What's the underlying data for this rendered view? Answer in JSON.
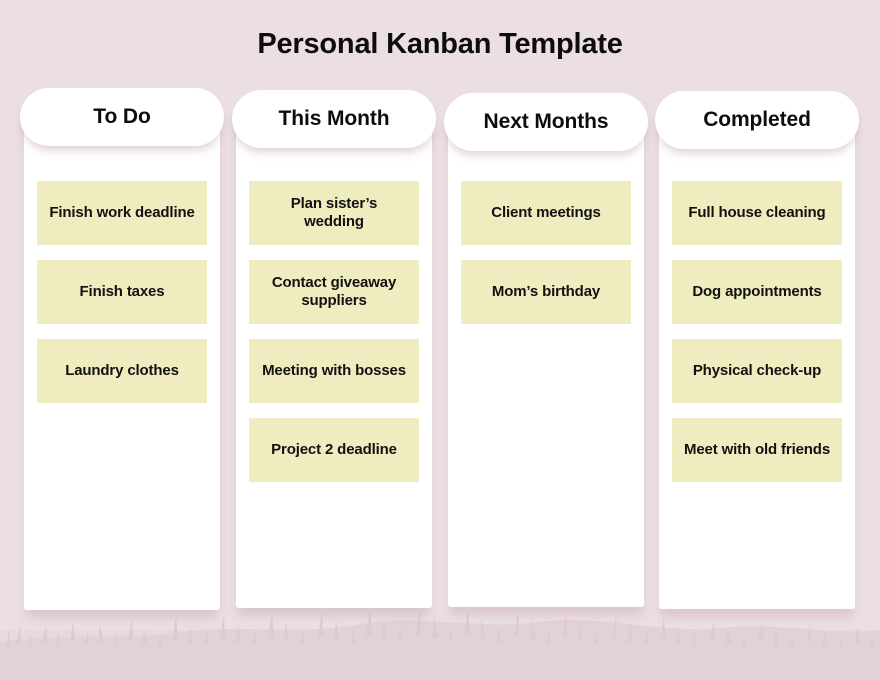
{
  "page": {
    "title": "Personal Kanban Template",
    "background_color": "#ebdfe2",
    "panel_color": "#ffffff",
    "card_color": "#efedc0",
    "text_color": "#0e0d0d",
    "grass_color": "#e2d2d6"
  },
  "columns": [
    {
      "id": "to-do",
      "header": "To Do",
      "cards": [
        {
          "label": "Finish work deadline"
        },
        {
          "label": "Finish taxes"
        },
        {
          "label": "Laundry clothes"
        }
      ]
    },
    {
      "id": "this-month",
      "header": "This Month",
      "cards": [
        {
          "label": "Plan sister’s wedding"
        },
        {
          "label": "Contact giveaway suppliers"
        },
        {
          "label": "Meeting with bosses"
        },
        {
          "label": "Project 2 deadline"
        }
      ]
    },
    {
      "id": "next-months",
      "header": "Next Months",
      "cards": [
        {
          "label": "Client meetings"
        },
        {
          "label": "Mom’s birthday"
        }
      ]
    },
    {
      "id": "completed",
      "header": "Completed",
      "cards": [
        {
          "label": "Full house cleaning"
        },
        {
          "label": "Dog appointments"
        },
        {
          "label": "Physical check-up"
        },
        {
          "label": "Meet with old friends"
        }
      ]
    }
  ]
}
